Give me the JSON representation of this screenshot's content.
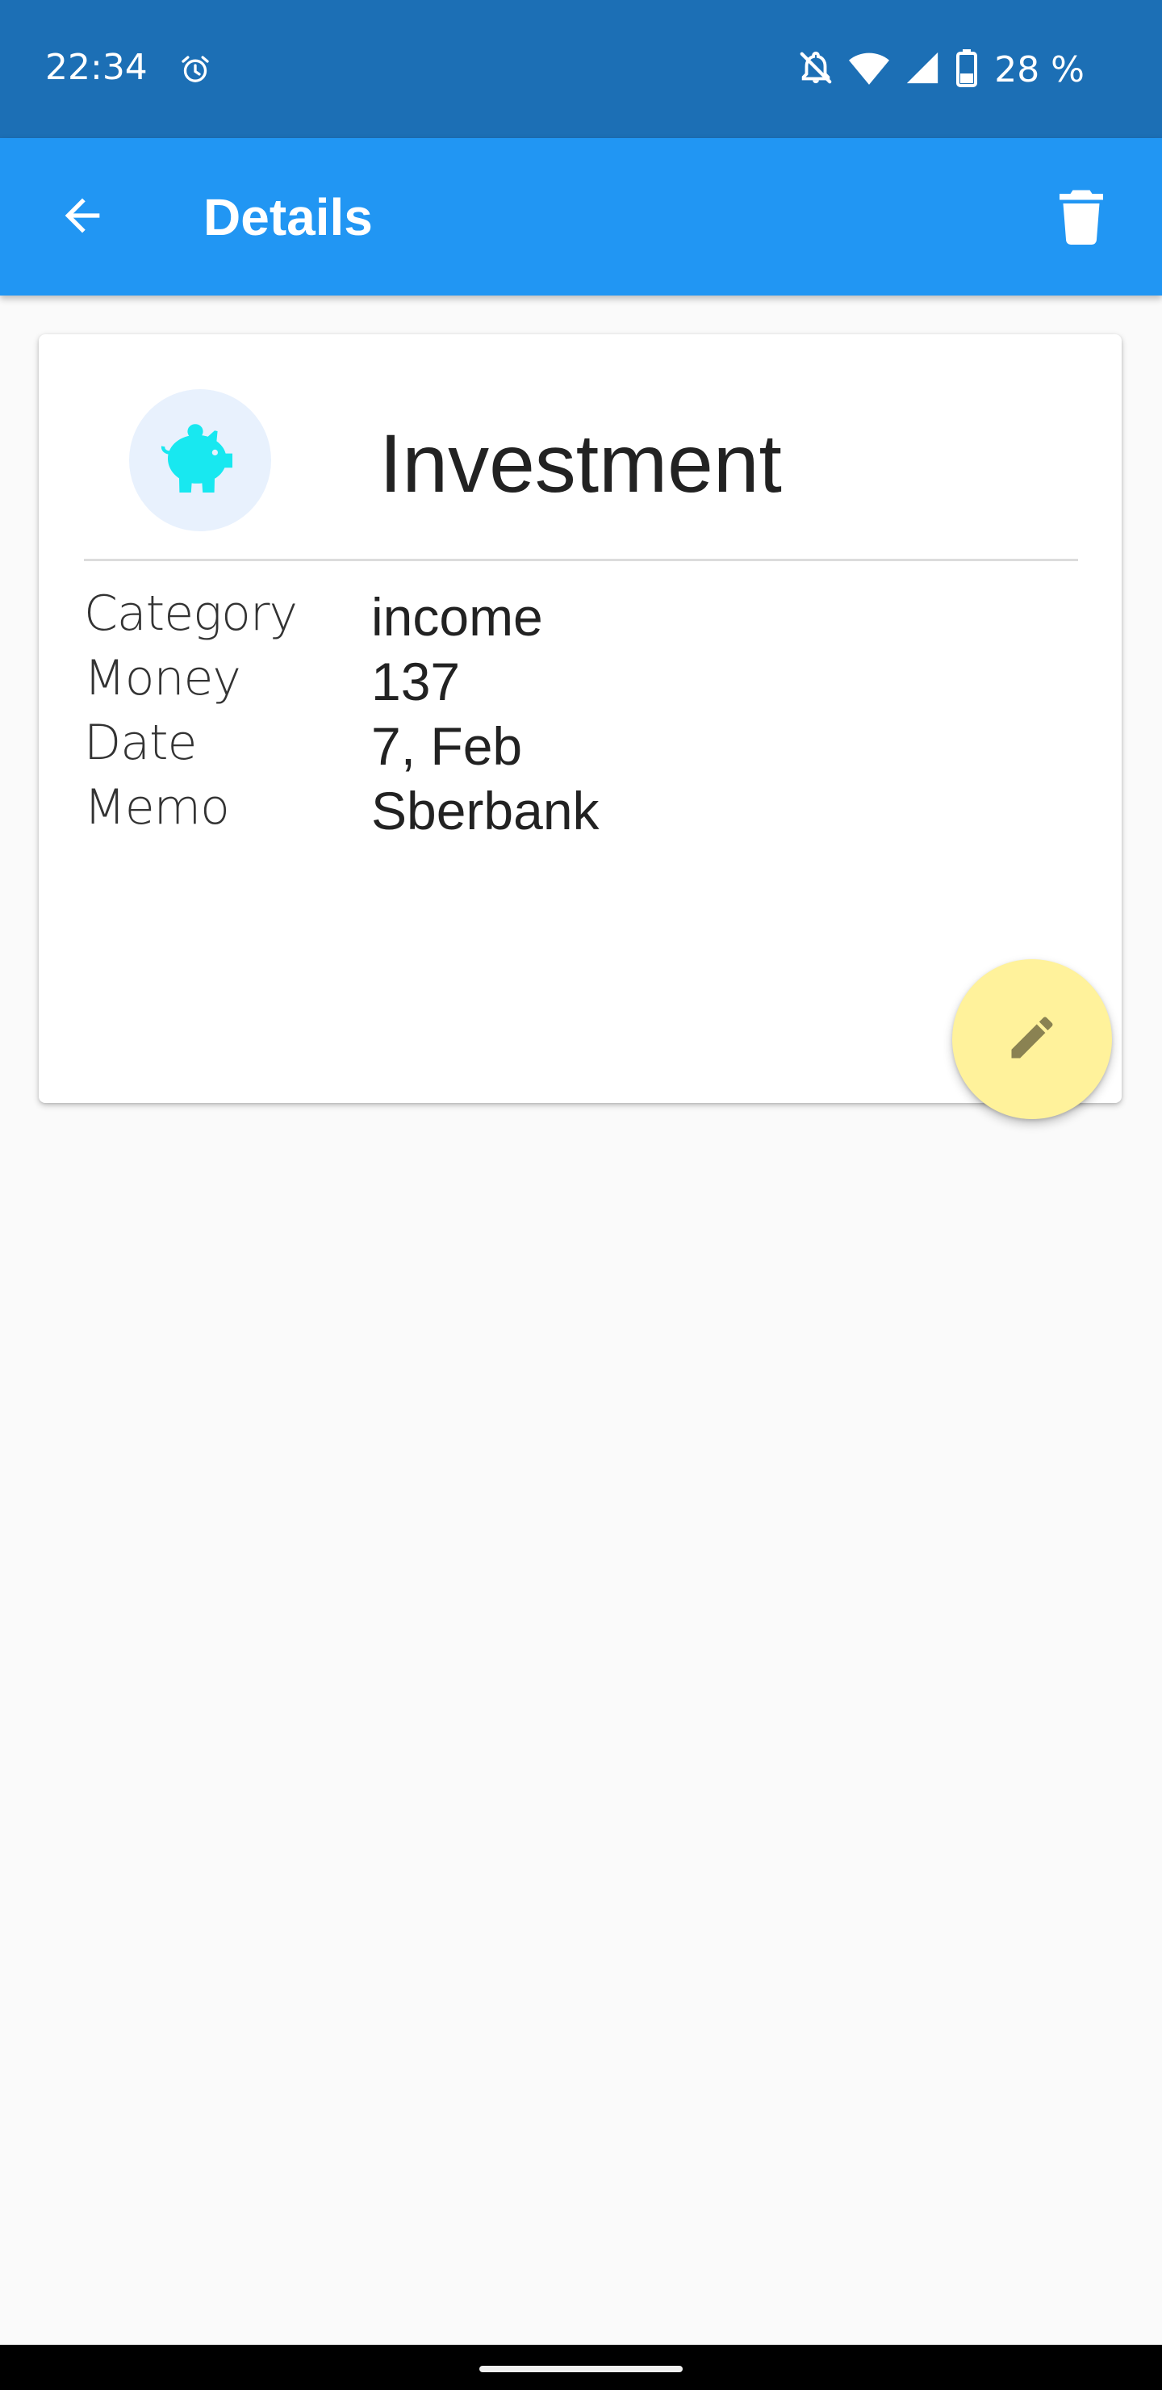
{
  "status_bar": {
    "time": "22:34",
    "battery": "28 %",
    "icons": [
      "alarm-icon",
      "notifications-off-icon",
      "wifi-icon",
      "cell-signal-icon",
      "battery-icon"
    ]
  },
  "app_bar": {
    "title": "Details",
    "back_icon": "arrow-back-icon",
    "delete_icon": "trash-icon",
    "color": "#2196f3"
  },
  "card": {
    "title": "Investment",
    "avatar_icon": "piggy-bank-icon",
    "avatar_icon_color": "#18e8f0",
    "rows": [
      {
        "label": "Category",
        "value": "income"
      },
      {
        "label": "Money",
        "value": "137"
      },
      {
        "label": "Date",
        "value": "7, Feb"
      },
      {
        "label": "Memo",
        "value": "Sberbank"
      }
    ]
  },
  "fab": {
    "icon": "pencil-icon",
    "color": "#fff29b"
  }
}
